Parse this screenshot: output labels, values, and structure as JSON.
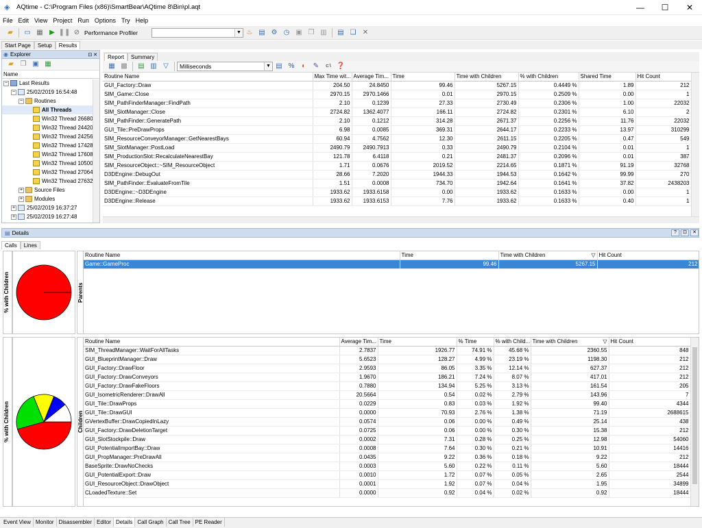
{
  "window": {
    "title": "AQtime - C:\\Program Files (x86)\\SmartBear\\AQtime 8\\Bin\\pl.aqt",
    "min": "—",
    "max": "☐",
    "close": "✕"
  },
  "menu": [
    "File",
    "Edit",
    "View",
    "Project",
    "Run",
    "Options",
    "Try",
    "Help"
  ],
  "toolbar": {
    "profiler": "Performance Profiler"
  },
  "top_tabs": [
    "Start Page",
    "Setup",
    "Results"
  ],
  "explorer": {
    "title": "Explorer",
    "column": "Name",
    "tree": [
      {
        "label": "Last Results",
        "level": 0,
        "icon": "results",
        "exp": "−"
      },
      {
        "label": "25/02/2019 16:54:48",
        "level": 1,
        "icon": "date",
        "exp": "−"
      },
      {
        "label": "Routines",
        "level": 2,
        "icon": "folder",
        "exp": "−"
      },
      {
        "label": "All Threads",
        "level": 3,
        "icon": "thread",
        "exp": "",
        "bold": true,
        "sel": true
      },
      {
        "label": "Win32 Thread 26680",
        "level": 3,
        "icon": "thread",
        "exp": ""
      },
      {
        "label": "Win32 Thread 24420",
        "level": 3,
        "icon": "thread",
        "exp": ""
      },
      {
        "label": "Win32 Thread 24256",
        "level": 3,
        "icon": "thread",
        "exp": ""
      },
      {
        "label": "Win32 Thread 17428",
        "level": 3,
        "icon": "thread",
        "exp": ""
      },
      {
        "label": "Win32 Thread 17608",
        "level": 3,
        "icon": "thread",
        "exp": ""
      },
      {
        "label": "Win32 Thread 10500",
        "level": 3,
        "icon": "thread",
        "exp": ""
      },
      {
        "label": "Win32 Thread 27064",
        "level": 3,
        "icon": "thread",
        "exp": ""
      },
      {
        "label": "Win32 Thread 27632",
        "level": 3,
        "icon": "thread",
        "exp": ""
      },
      {
        "label": "Source Files",
        "level": 2,
        "icon": "folder",
        "exp": "+"
      },
      {
        "label": "Modules",
        "level": 2,
        "icon": "folder",
        "exp": "+"
      },
      {
        "label": "25/02/2019 16:37:27",
        "level": 1,
        "icon": "date",
        "exp": "+"
      },
      {
        "label": "25/02/2019 16:27:48",
        "level": 1,
        "icon": "date",
        "exp": "+"
      }
    ]
  },
  "report": {
    "tabs": [
      "Report",
      "Summary"
    ],
    "units": "Milliseconds",
    "columns": [
      "Routine Name",
      "Max Time wit...",
      "Average Tim...",
      "Time",
      "Time with Children",
      "% with Children",
      "Shared Time",
      "Hit Count"
    ],
    "rows": [
      [
        "GUI_Factory::Draw",
        "204.50",
        "24.8450",
        "99.46",
        "5267.15",
        "0.4449 %",
        "1.89",
        "212"
      ],
      [
        "SIM_Game::Close",
        "2970.15",
        "2970.1466",
        "0.01",
        "2970.15",
        "0.2509 %",
        "0.00",
        "1"
      ],
      [
        "SIM_PathFinderManager::FindPath",
        "2.10",
        "0.1239",
        "27.33",
        "2730.49",
        "0.2306 %",
        "1.00",
        "22032"
      ],
      [
        "SIM_SlotManager::Close",
        "2724.82",
        "1362.4077",
        "166.11",
        "2724.82",
        "0.2301 %",
        "6.10",
        "2"
      ],
      [
        "SIM_PathFinder::GeneratePath",
        "2.10",
        "0.1212",
        "314.28",
        "2671.37",
        "0.2256 %",
        "11.76",
        "22032"
      ],
      [
        "GUI_Tile::PreDrawProps",
        "6.98",
        "0.0085",
        "369.31",
        "2644.17",
        "0.2233 %",
        "13.97",
        "310299"
      ],
      [
        "SIM_ResourceConveyorManager::GetNearestBays",
        "60.94",
        "4.7562",
        "12.30",
        "2611.15",
        "0.2205 %",
        "0.47",
        "549"
      ],
      [
        "SIM_SlotManager::PostLoad",
        "2490.79",
        "2490.7913",
        "0.33",
        "2490.79",
        "0.2104 %",
        "0.01",
        "1"
      ],
      [
        "SIM_ProductionSlot::RecalculateNearestBay",
        "121.78",
        "6.4118",
        "0.21",
        "2481.37",
        "0.2096 %",
        "0.01",
        "387"
      ],
      [
        "SIM_ResourceObject::~SIM_ResourceObject",
        "1.71",
        "0.0676",
        "2019.52",
        "2214.65",
        "0.1871 %",
        "91.19",
        "32768"
      ],
      [
        "D3DEngine::DebugOut",
        "28.66",
        "7.2020",
        "1944.33",
        "1944.53",
        "0.1642 %",
        "99.99",
        "270"
      ],
      [
        "SIM_PathFinder::EvaluateFromTile",
        "1.51",
        "0.0008",
        "734.70",
        "1942.64",
        "0.1641 %",
        "37.82",
        "2438203"
      ],
      [
        "D3DEngine::~D3DEngine",
        "1933.62",
        "1933.6158",
        "0.00",
        "1933.62",
        "0.1633 %",
        "0.00",
        "1"
      ],
      [
        "D3DEngine::Release",
        "1933.62",
        "1933.6153",
        "7.76",
        "1933.62",
        "0.1633 %",
        "0.40",
        "1"
      ]
    ]
  },
  "details": {
    "title": "Details",
    "tabs": [
      "Calls",
      "Lines"
    ],
    "pie_label": "% with Children",
    "parents_label": "Parents",
    "children_label": "Children",
    "parents": {
      "columns": [
        "Routine Name",
        "Time",
        "Time with Children",
        "Hit Count"
      ],
      "rows": [
        [
          "Game::GameProc",
          "99.46",
          "5267.15",
          "212"
        ]
      ]
    },
    "children": {
      "columns": [
        "Routine Name",
        "Average Tim...",
        "Time",
        "% Time",
        "% with Child...",
        "Time with Children",
        "Hit Count"
      ],
      "rows": [
        [
          "SIM_ThreadManager::WaitForAllTasks",
          "2.7837",
          "1926.77",
          "74.91 %",
          "45.68 %",
          "2360.55",
          "848"
        ],
        [
          "GUI_BlueprintManager::Draw",
          "5.6523",
          "128.27",
          "4.99 %",
          "23.19 %",
          "1198.30",
          "212"
        ],
        [
          "GUI_Factory::DrawFloor",
          "2.9593",
          "86.05",
          "3.35 %",
          "12.14 %",
          "627.37",
          "212"
        ],
        [
          "GUI_Factory::DrawConveyors",
          "1.9670",
          "186.21",
          "7.24 %",
          "8.07 %",
          "417.01",
          "212"
        ],
        [
          "GUI_Factory::DrawFakeFloors",
          "0.7880",
          "134.94",
          "5.25 %",
          "3.13 %",
          "161.54",
          "205"
        ],
        [
          "GUI_IsometricRenderer::DrawAll",
          "20.5664",
          "0.54",
          "0.02 %",
          "2.79 %",
          "143.96",
          "7"
        ],
        [
          "GUI_Tile::DrawProps",
          "0.0229",
          "0.83",
          "0.03 %",
          "1.92 %",
          "99.40",
          "4344"
        ],
        [
          "GUI_Tile::DrawGUI",
          "0.0000",
          "70.93",
          "2.76 %",
          "1.38 %",
          "71.19",
          "2688615"
        ],
        [
          "GVertexBuffer::DrawCopiedInLazy",
          "0.0574",
          "0.06",
          "0.00 %",
          "0.49 %",
          "25.14",
          "438"
        ],
        [
          "GUI_Factory::DrawDeletionTarget",
          "0.0725",
          "0.06",
          "0.00 %",
          "0.30 %",
          "15.38",
          "212"
        ],
        [
          "GUI_SlotStockpile::Draw",
          "0.0002",
          "7.31",
          "0.28 %",
          "0.25 %",
          "12.98",
          "54060"
        ],
        [
          "GUI_PotentialImportBay::Draw",
          "0.0008",
          "7.64",
          "0.30 %",
          "0.21 %",
          "10.91",
          "14416"
        ],
        [
          "GUI_PropManager::PreDrawAll",
          "0.0435",
          "9.22",
          "0.36 %",
          "0.18 %",
          "9.22",
          "212"
        ],
        [
          "BaseSprite::DrawNoChecks",
          "0.0003",
          "5.60",
          "0.22 %",
          "0.11 %",
          "5.60",
          "18444"
        ],
        [
          "GUI_PotentialExport::Draw",
          "0.0010",
          "1.72",
          "0.07 %",
          "0.05 %",
          "2.65",
          "2544"
        ],
        [
          "GUI_ResourceObject::DrawObject",
          "0.0001",
          "1.92",
          "0.07 %",
          "0.04 %",
          "1.95",
          "34899"
        ],
        [
          "CLoadedTexture::Set",
          "0.0000",
          "0.92",
          "0.04 %",
          "0.02 %",
          "0.92",
          "18444"
        ]
      ]
    },
    "parents_pie": [
      {
        "value": 100,
        "color": "#ff0000"
      }
    ],
    "children_pie": [
      {
        "value": 45.68,
        "color": "#ff0000"
      },
      {
        "value": 23.19,
        "color": "#00e000"
      },
      {
        "value": 12.14,
        "color": "#ffff00"
      },
      {
        "value": 8.07,
        "color": "#0000ff"
      },
      {
        "value": 10.92,
        "color": "#ffffff"
      }
    ]
  },
  "bottom_tabs": [
    "Event View",
    "Monitor",
    "Disassembler",
    "Editor",
    "Details",
    "Call Graph",
    "Call Tree",
    "PE Reader"
  ],
  "bottom_active": "Details"
}
